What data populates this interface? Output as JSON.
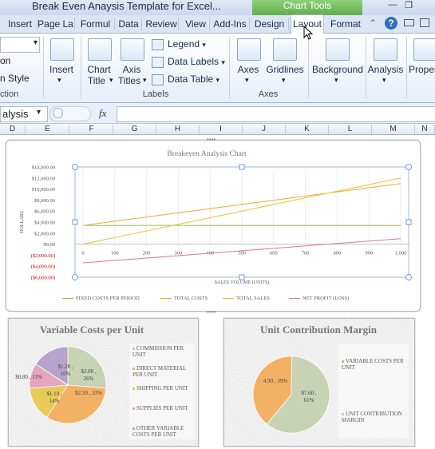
{
  "window": {
    "title": "Break Even Anaysis Template for Excel...",
    "context_tab": "Chart Tools",
    "colors": {
      "accent": "#5fae4c",
      "ribbon": "#dbe6f4"
    }
  },
  "tabs": [
    "Insert",
    "Page La",
    "Formul",
    "Data",
    "Review",
    "View",
    "Add-Ins",
    "Design",
    "Layout",
    "Format"
  ],
  "active_tab": "Layout",
  "ribbon": {
    "left_partial": [
      "on",
      "n Style",
      "ction"
    ],
    "insert_label": "Insert",
    "chart_title": [
      "Chart",
      "Title"
    ],
    "axis_titles": [
      "Axis",
      "Titles"
    ],
    "legend": "Legend",
    "data_labels": "Data Labels",
    "data_table": "Data Table",
    "labels_group": "Labels",
    "axes": "Axes",
    "gridlines": "Gridlines",
    "axes_group": "Axes",
    "background": "Background",
    "analysis": "Analysis",
    "properties": "Propert"
  },
  "formula_bar": {
    "name_box": "alysis",
    "fx": "fx"
  },
  "columns": [
    "D",
    "E",
    "F",
    "G",
    "H",
    "I",
    "J",
    "K",
    "L",
    "M",
    "N"
  ],
  "chart_data": [
    {
      "type": "line",
      "title": "Breakeven  Analysis  Chart",
      "xlabel": "SALES  VOLUME  (UNITS)",
      "ylabel": "DOLLARS",
      "x": [
        0,
        100,
        200,
        300,
        400,
        500,
        600,
        700,
        800,
        900,
        1000
      ],
      "x_tick_labels": [
        "0",
        "100",
        "200",
        "300",
        "400",
        "500",
        "600",
        "700",
        "800",
        "900",
        "1,000"
      ],
      "ylim": [
        -6000,
        14000
      ],
      "y_tick_labels": [
        "$14,000.00",
        "$12,000.00",
        "$10,000.00",
        "$8,000.00",
        "$6,000.00",
        "$4,000.00",
        "$2,000.00",
        "$0.00",
        "($2,000.00)",
        "($4,000.00)",
        "($6,000.00)"
      ],
      "series": [
        {
          "name": "FIXED COSTS PER PERIOD",
          "color": "#9bbb59",
          "values": [
            3400,
            3400,
            3400,
            3400,
            3400,
            3400,
            3400,
            3400,
            3400,
            3400,
            3400
          ]
        },
        {
          "name": "TOTAL COSTS",
          "color": "#f0a830",
          "values": [
            3400,
            4160,
            4920,
            5680,
            6440,
            7200,
            7960,
            8720,
            9480,
            10240,
            11000
          ]
        },
        {
          "name": "TOTAL SALES",
          "color": "#e8c030",
          "values": [
            0,
            1200,
            2400,
            3600,
            4800,
            6000,
            7200,
            8400,
            9600,
            10800,
            12000
          ]
        },
        {
          "name": "NET PROFIT (LOSS)",
          "color": "#d9779a",
          "values": [
            -3400,
            -2960,
            -2520,
            -2080,
            -1640,
            -1200,
            -760,
            -320,
            120,
            560,
            1000
          ]
        }
      ]
    },
    {
      "type": "pie",
      "title": "Variable Costs per Unit",
      "slices": [
        {
          "name": "COMMISSION PER UNIT",
          "value": 2.0,
          "label": "$2.00 ,\n26%",
          "color": "#c7d3b4"
        },
        {
          "name": "DIRECT MATERIAL PER UNIT",
          "value": 2.5,
          "label": "$2.50 , 33%",
          "color": "#f3b165"
        },
        {
          "name": "SHIPPING PER UNIT",
          "value": 1.1,
          "label": "$1.10 ,\n14%",
          "color": "#e8c95a"
        },
        {
          "name": "SUPPLIES PER UNIT",
          "value": 0.8,
          "label": "$0.80 , 11%",
          "color": "#e6a5bd"
        },
        {
          "name": "OTHER VARIABLE COSTS PER UNIT",
          "value": 1.2,
          "label": "$1.20 ,\n16%",
          "color": "#b6a4cd"
        }
      ]
    },
    {
      "type": "pie",
      "title": "Unit Contribution Margin",
      "slices": [
        {
          "name": "VARIABLE COSTS PER UNIT",
          "value": 4.9,
          "label": "4.90 , 39%",
          "color": "#f3b165"
        },
        {
          "name": "UNIT CONTRIBUTION MARGIN",
          "value": 7.6,
          "label": "$7.60 ,\n61%",
          "color": "#c7d3b4"
        }
      ]
    }
  ]
}
